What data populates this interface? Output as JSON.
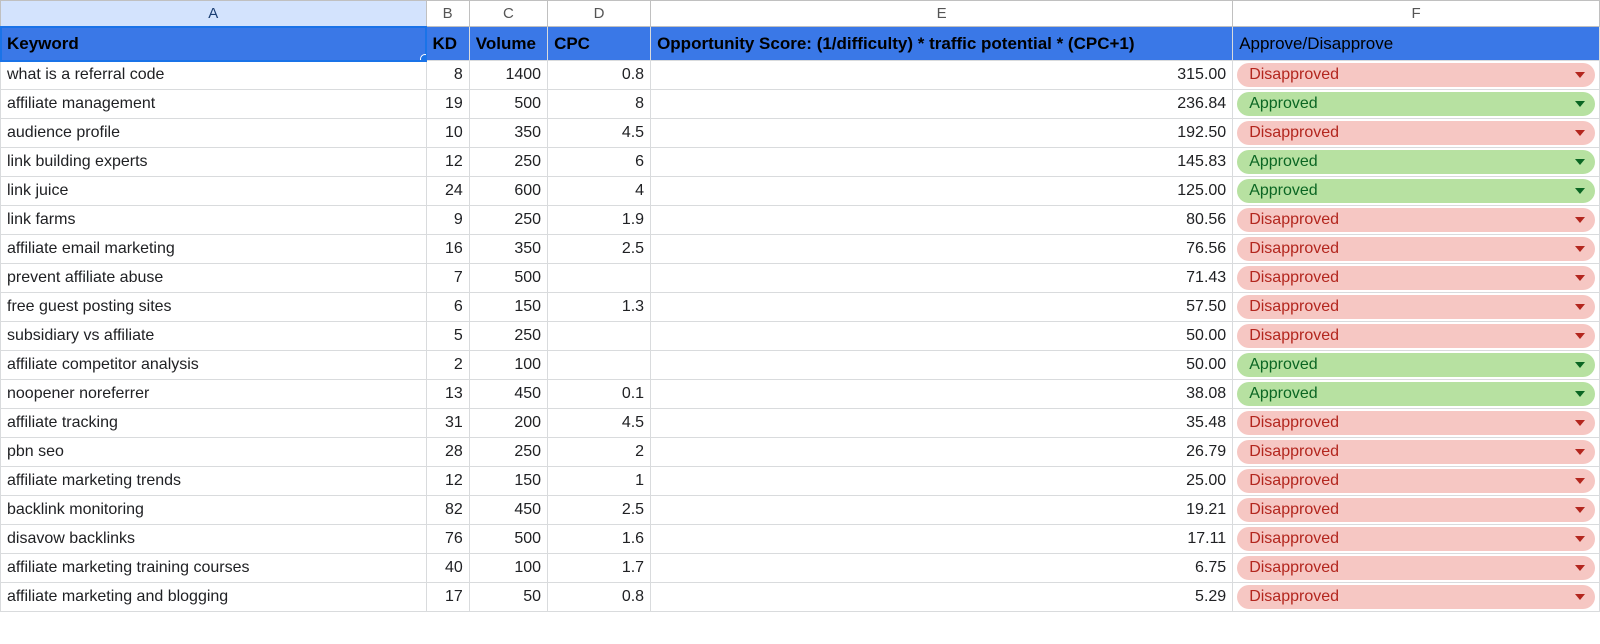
{
  "columns": [
    "A",
    "B",
    "C",
    "D",
    "E",
    "F"
  ],
  "selected_column_index": 0,
  "headers": {
    "a": "Keyword",
    "b": "KD",
    "c": "Volume",
    "d": "CPC",
    "e": "Opportunity Score: (1/difficulty) * traffic potential * (CPC+1)",
    "f": "Approve/Disapprove"
  },
  "status_labels": {
    "approved": "Approved",
    "disapproved": "Disapproved"
  },
  "rows": [
    {
      "keyword": "what is a referral code",
      "kd": "8",
      "volume": "1400",
      "cpc": "0.8",
      "score": "315.00",
      "status": "disapproved"
    },
    {
      "keyword": "affiliate management",
      "kd": "19",
      "volume": "500",
      "cpc": "8",
      "score": "236.84",
      "status": "approved"
    },
    {
      "keyword": "audience profile",
      "kd": "10",
      "volume": "350",
      "cpc": "4.5",
      "score": "192.50",
      "status": "disapproved"
    },
    {
      "keyword": "link building experts",
      "kd": "12",
      "volume": "250",
      "cpc": "6",
      "score": "145.83",
      "status": "approved"
    },
    {
      "keyword": "link juice",
      "kd": "24",
      "volume": "600",
      "cpc": "4",
      "score": "125.00",
      "status": "approved"
    },
    {
      "keyword": "link farms",
      "kd": "9",
      "volume": "250",
      "cpc": "1.9",
      "score": "80.56",
      "status": "disapproved"
    },
    {
      "keyword": "affiliate email marketing",
      "kd": "16",
      "volume": "350",
      "cpc": "2.5",
      "score": "76.56",
      "status": "disapproved"
    },
    {
      "keyword": "prevent affiliate abuse",
      "kd": "7",
      "volume": "500",
      "cpc": "",
      "score": "71.43",
      "status": "disapproved"
    },
    {
      "keyword": "free guest posting sites",
      "kd": "6",
      "volume": "150",
      "cpc": "1.3",
      "score": "57.50",
      "status": "disapproved"
    },
    {
      "keyword": "subsidiary vs affiliate",
      "kd": "5",
      "volume": "250",
      "cpc": "",
      "score": "50.00",
      "status": "disapproved"
    },
    {
      "keyword": "affiliate competitor analysis",
      "kd": "2",
      "volume": "100",
      "cpc": "",
      "score": "50.00",
      "status": "approved"
    },
    {
      "keyword": "noopener noreferrer",
      "kd": "13",
      "volume": "450",
      "cpc": "0.1",
      "score": "38.08",
      "status": "approved"
    },
    {
      "keyword": "affiliate tracking",
      "kd": "31",
      "volume": "200",
      "cpc": "4.5",
      "score": "35.48",
      "status": "disapproved"
    },
    {
      "keyword": "pbn seo",
      "kd": "28",
      "volume": "250",
      "cpc": "2",
      "score": "26.79",
      "status": "disapproved"
    },
    {
      "keyword": "affiliate marketing trends",
      "kd": "12",
      "volume": "150",
      "cpc": "1",
      "score": "25.00",
      "status": "disapproved"
    },
    {
      "keyword": "backlink monitoring",
      "kd": "82",
      "volume": "450",
      "cpc": "2.5",
      "score": "19.21",
      "status": "disapproved"
    },
    {
      "keyword": "disavow backlinks",
      "kd": "76",
      "volume": "500",
      "cpc": "1.6",
      "score": "17.11",
      "status": "disapproved"
    },
    {
      "keyword": "affiliate marketing training courses",
      "kd": "40",
      "volume": "100",
      "cpc": "1.7",
      "score": "6.75",
      "status": "disapproved"
    },
    {
      "keyword": "affiliate marketing and blogging",
      "kd": "17",
      "volume": "50",
      "cpc": "0.8",
      "score": "5.29",
      "status": "disapproved"
    }
  ],
  "chart_data": {
    "type": "table",
    "columns": [
      "Keyword",
      "KD",
      "Volume",
      "CPC",
      "Opportunity Score",
      "Approve/Disapprove"
    ],
    "rows": [
      [
        "what is a referral code",
        8,
        1400,
        0.8,
        315.0,
        "Disapproved"
      ],
      [
        "affiliate management",
        19,
        500,
        8,
        236.84,
        "Approved"
      ],
      [
        "audience profile",
        10,
        350,
        4.5,
        192.5,
        "Disapproved"
      ],
      [
        "link building experts",
        12,
        250,
        6,
        145.83,
        "Approved"
      ],
      [
        "link juice",
        24,
        600,
        4,
        125.0,
        "Approved"
      ],
      [
        "link farms",
        9,
        250,
        1.9,
        80.56,
        "Disapproved"
      ],
      [
        "affiliate email marketing",
        16,
        350,
        2.5,
        76.56,
        "Disapproved"
      ],
      [
        "prevent affiliate abuse",
        7,
        500,
        null,
        71.43,
        "Disapproved"
      ],
      [
        "free guest posting sites",
        6,
        150,
        1.3,
        57.5,
        "Disapproved"
      ],
      [
        "subsidiary vs affiliate",
        5,
        250,
        null,
        50.0,
        "Disapproved"
      ],
      [
        "affiliate competitor analysis",
        2,
        100,
        null,
        50.0,
        "Approved"
      ],
      [
        "noopener noreferrer",
        13,
        450,
        0.1,
        38.08,
        "Approved"
      ],
      [
        "affiliate tracking",
        31,
        200,
        4.5,
        35.48,
        "Disapproved"
      ],
      [
        "pbn seo",
        28,
        250,
        2,
        26.79,
        "Disapproved"
      ],
      [
        "affiliate marketing trends",
        12,
        150,
        1,
        25.0,
        "Disapproved"
      ],
      [
        "backlink monitoring",
        82,
        450,
        2.5,
        19.21,
        "Disapproved"
      ],
      [
        "disavow backlinks",
        76,
        500,
        1.6,
        17.11,
        "Disapproved"
      ],
      [
        "affiliate marketing training courses",
        40,
        100,
        1.7,
        6.75,
        "Disapproved"
      ],
      [
        "affiliate marketing and blogging",
        17,
        50,
        0.8,
        5.29,
        "Disapproved"
      ]
    ]
  }
}
